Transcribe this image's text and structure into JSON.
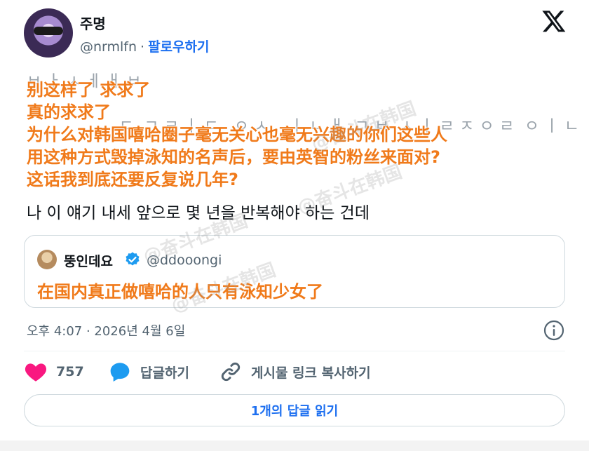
{
  "author": {
    "display_name": "주명",
    "handle": "@nrmlfn",
    "separator": "·",
    "follow_label": "팔로우하기",
    "avatar_icon": "user-avatar"
  },
  "platform_logo": "x-logo-icon",
  "post": {
    "korean_faded_lines": "ㅂ ㅏ ㅅ ㅔ ㅐ ㅂ\n\n                  ㄷ  ㄱ ㄹ ㅣ ㄷ   ㅇ ㅅ    ㅣ ㄴ ㅐ  ㄱ ㅂ  ㅅ ㅣ ㄹ ㅈ ㅇ ㄹ  ㅇ ㅣ ㄴ",
    "korean_body": "나 이 얘기 내세 앞으로 몇 년을 반복해야 하는 건데",
    "overlay_lines": [
      "别这样了 求求了",
      "真的求求了",
      "为什么对韩国嘻哈圈子毫无关心也毫无兴趣的你们这些人",
      "用这种方式毁掉泳知的名声后，要由英智的粉丝来面对?",
      "这话我到底还要反复说几年?"
    ]
  },
  "quoted_post": {
    "display_name": "뚱인데요",
    "verified": true,
    "handle": "@ddooongi",
    "overlay_text": "在国内真正做嘻哈的人只有泳知少女了"
  },
  "timestamp": "오후 4:07 · 2026년 4월 6일",
  "actions": {
    "like_count": "757",
    "reply_label": "답글하기",
    "copy_link_label": "게시물 링크 복사하기"
  },
  "read_replies_label": "1개의 답글 읽기",
  "watermarks": [
    "@奋斗在韩国",
    "@奋斗在韩国",
    "@奋斗在韩国",
    "@奋斗在韩国"
  ],
  "colors": {
    "accent": "#1d6ff0",
    "overlay_text": "#f07a1a",
    "like": "#f91880",
    "secondary_text": "#536471"
  }
}
